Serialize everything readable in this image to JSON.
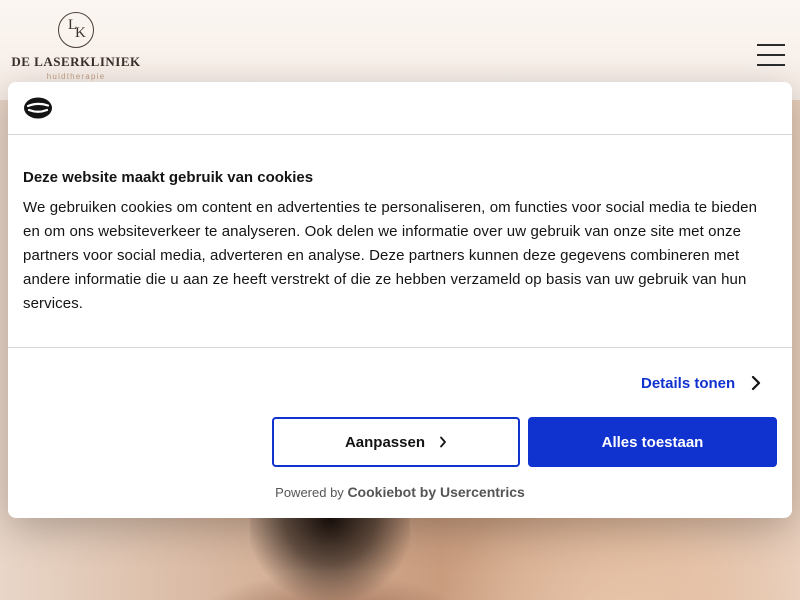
{
  "site": {
    "logo_monogram_l": "L",
    "logo_monogram_k": "K",
    "logo_name": "DE LASERKLINIEK",
    "logo_subtitle": "huidtherapie",
    "menu_icon": "hamburger-icon"
  },
  "cookie_banner": {
    "logo_icon": "cookiebot-icon",
    "title": "Deze website maakt gebruik van cookies",
    "body": "We gebruiken cookies om content en advertenties te personaliseren, om functies voor social media te bieden en om ons websiteverkeer te analyseren. Ook delen we informatie over uw gebruik van onze site met onze partners voor social media, adverteren en analyse. Deze partners kunnen deze gegevens combineren met andere informatie die u aan ze heeft verstrekt of die ze hebben verzameld op basis van uw gebruik van hun services.",
    "details_label": "Details tonen",
    "customize_label": "Aanpassen",
    "allow_all_label": "Alles toestaan",
    "powered_by_prefix": "Powered by",
    "powered_by_brand": "Cookiebot by Usercentrics",
    "accent_color": "#1032cf"
  }
}
